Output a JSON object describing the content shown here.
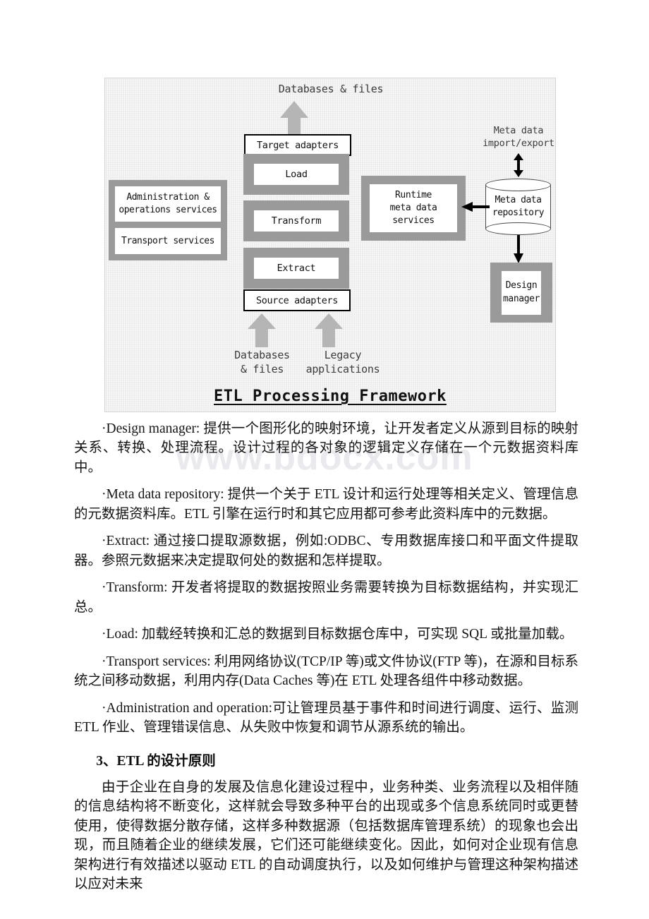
{
  "watermark": {
    "text": "www.bdocx.com"
  },
  "figure": {
    "title": "ETL Processing Framework",
    "top_caption": "Databases & files",
    "meta_io_caption": "Meta data\nimport/export",
    "adapters": {
      "target": "Target adapters",
      "source": "Source adapters"
    },
    "stages": [
      {
        "label": "Load"
      },
      {
        "label": "Transform"
      },
      {
        "label": "Extract"
      }
    ],
    "left_panel": {
      "rows": [
        {
          "label": "Administration &\noperations services"
        },
        {
          "label": "Transport services"
        }
      ]
    },
    "runtime_box": {
      "label": "Runtime\nmeta data\nservices"
    },
    "repository": {
      "label": "Meta data\nrepository"
    },
    "design_manager": {
      "label": "Design\nmanager"
    },
    "bottom_sources": [
      {
        "label": "Databases\n& files"
      },
      {
        "label": "Legacy\napplications"
      }
    ]
  },
  "body": {
    "paragraphs": [
      "·Design manager: 提供一个图形化的映射环境，让开发者定义从源到目标的映射关系、转换、处理流程。设计过程的各对象的逻辑定义存储在一个元数据资料库中。",
      "·Meta data repository: 提供一个关于 ETL 设计和运行处理等相关定义、管理信息的元数据资料库。ETL 引擎在运行时和其它应用都可参考此资料库中的元数据。",
      "·Extract: 通过接口提取源数据，例如:ODBC、专用数据库接口和平面文件提取器。参照元数据来决定提取何处的数据和怎样提取。",
      "·Transform: 开发者将提取的数据按照业务需要转换为目标数据结构，并实现汇总。",
      "·Load: 加载经转换和汇总的数据到目标数据仓库中，可实现 SQL 或批量加载。",
      "·Transport services: 利用网络协议(TCP/IP 等)或文件协议(FTP 等)，在源和目标系统之间移动数据，利用内存(Data Caches 等)在 ETL 处理各组件中移动数据。",
      "·Administration and operation:可让管理员基于事件和时间进行调度、运行、监测 ETL 作业、管理错误信息、从失败中恢复和调节从源系统的输出。"
    ],
    "heading": "3、ETL 的设计原则",
    "closing_paragraph": "由于企业在自身的发展及信息化建设过程中，业务种类、业务流程以及相伴随的信息结构将不断变化，这样就会导致多种平台的出现或多个信息系统同时或更替使用，使得数据分散存储，这样多种数据源（包括数据库管理系统）的现象也会出现，而且随着企业的继续发展，它们还可能继续变化。因此，如何对企业现有信息架构进行有效描述以驱动 ETL 的自动调度执行，以及如何维护与管理这种架构描述以应对未来"
  }
}
